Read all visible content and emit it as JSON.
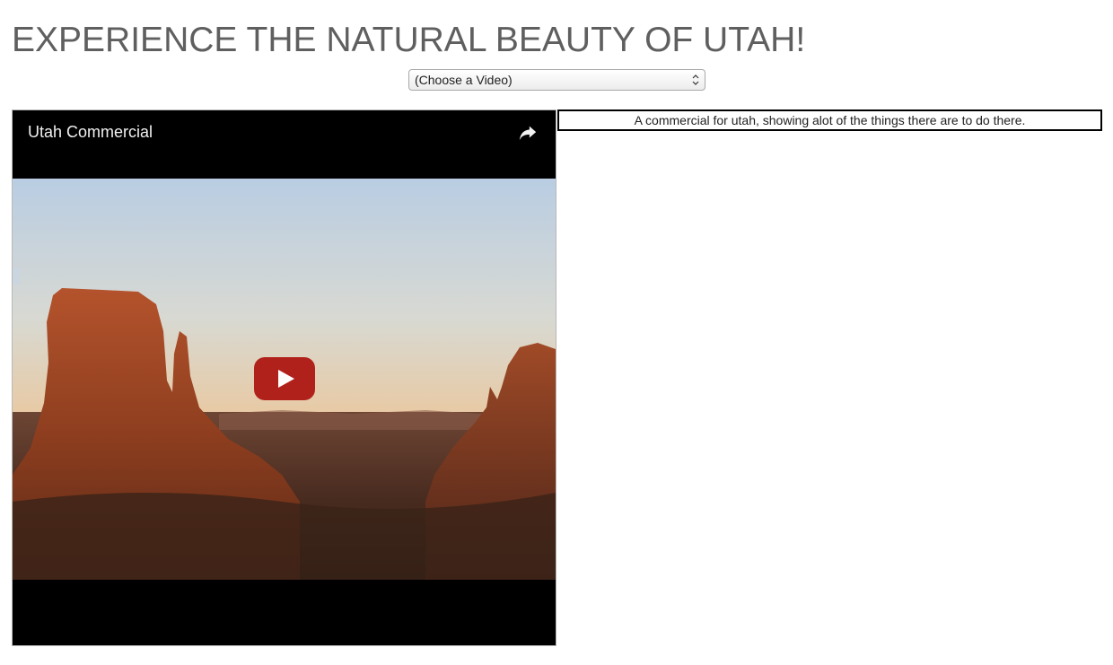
{
  "page": {
    "title": "EXPERIENCE THE NATURAL BEAUTY OF UTAH!"
  },
  "video_select": {
    "selected": "(Choose a Video)"
  },
  "player": {
    "video_title": "Utah Commercial",
    "icons": {
      "share": "share-arrow-icon",
      "play": "youtube-play-icon"
    },
    "colors": {
      "play_button": "#c4302b",
      "background": "#000000"
    }
  },
  "description": {
    "text": "A commercial for utah, showing alot of the things there are to do there."
  }
}
